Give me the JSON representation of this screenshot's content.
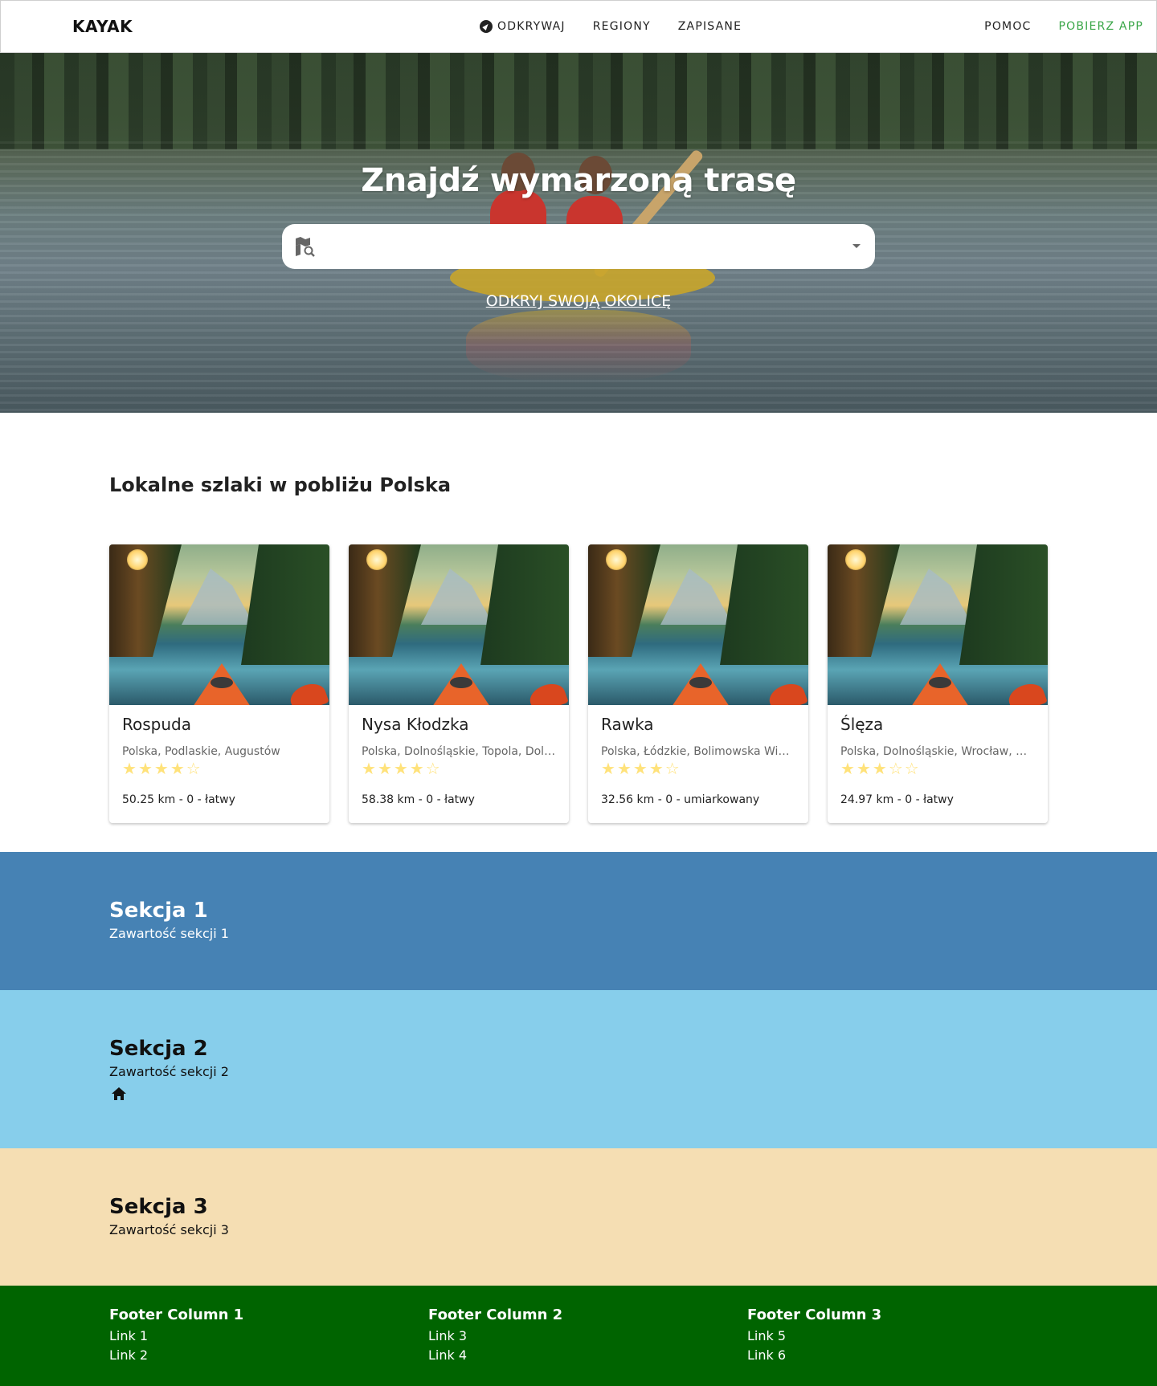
{
  "nav": {
    "logo": "KAYAK",
    "center": [
      "ODKRYWAJ",
      "REGIONY",
      "ZAPISANE"
    ],
    "right": [
      "POMOC",
      "POBIERZ APP"
    ],
    "accent": "#3aa648"
  },
  "hero": {
    "title": "Znajdź wymarzoną trasę",
    "search_value": "",
    "link": "ODKRYJ SWOJĄ OKOLICĘ"
  },
  "local": {
    "title": "Lokalne szlaki w pobliżu Polska",
    "cards": [
      {
        "name": "Rospuda",
        "location": "Polska, Podlaskie, Augustów",
        "rating": 4,
        "meta": "50.25 km - 0 - łatwy"
      },
      {
        "name": "Nysa Kłodzka",
        "location": "Polska, Dolnośląskie, Topola, Doli...",
        "rating": 4,
        "meta": "58.38 km - 0 - łatwy"
      },
      {
        "name": "Rawka",
        "location": "Polska, Łódzkie, Bolimowska Wie...",
        "rating": 4,
        "meta": "32.56 km - 0 - umiarkowany"
      },
      {
        "name": "Ślęza",
        "location": "Polska, Dolnośląskie, Wrocław, D...",
        "rating": 3,
        "meta": "24.97 km - 0 - łatwy"
      }
    ],
    "star_color": "#ffe27a"
  },
  "sections": [
    {
      "title": "Sekcja 1",
      "content": "Zawartość sekcji 1",
      "color": "#4682b4"
    },
    {
      "title": "Sekcja 2",
      "content": "Zawartość sekcji 2",
      "color": "#87ceeb"
    },
    {
      "title": "Sekcja 3",
      "content": "Zawartość sekcji 3",
      "color": "#f5deb3"
    }
  ],
  "footer": {
    "color": "#006400",
    "columns": [
      {
        "title": "Footer Column 1",
        "links": [
          "Link 1",
          "Link 2"
        ]
      },
      {
        "title": "Footer Column 2",
        "links": [
          "Link 3",
          "Link 4"
        ]
      },
      {
        "title": "Footer Column 3",
        "links": [
          "Link 5",
          "Link 6"
        ]
      }
    ]
  }
}
